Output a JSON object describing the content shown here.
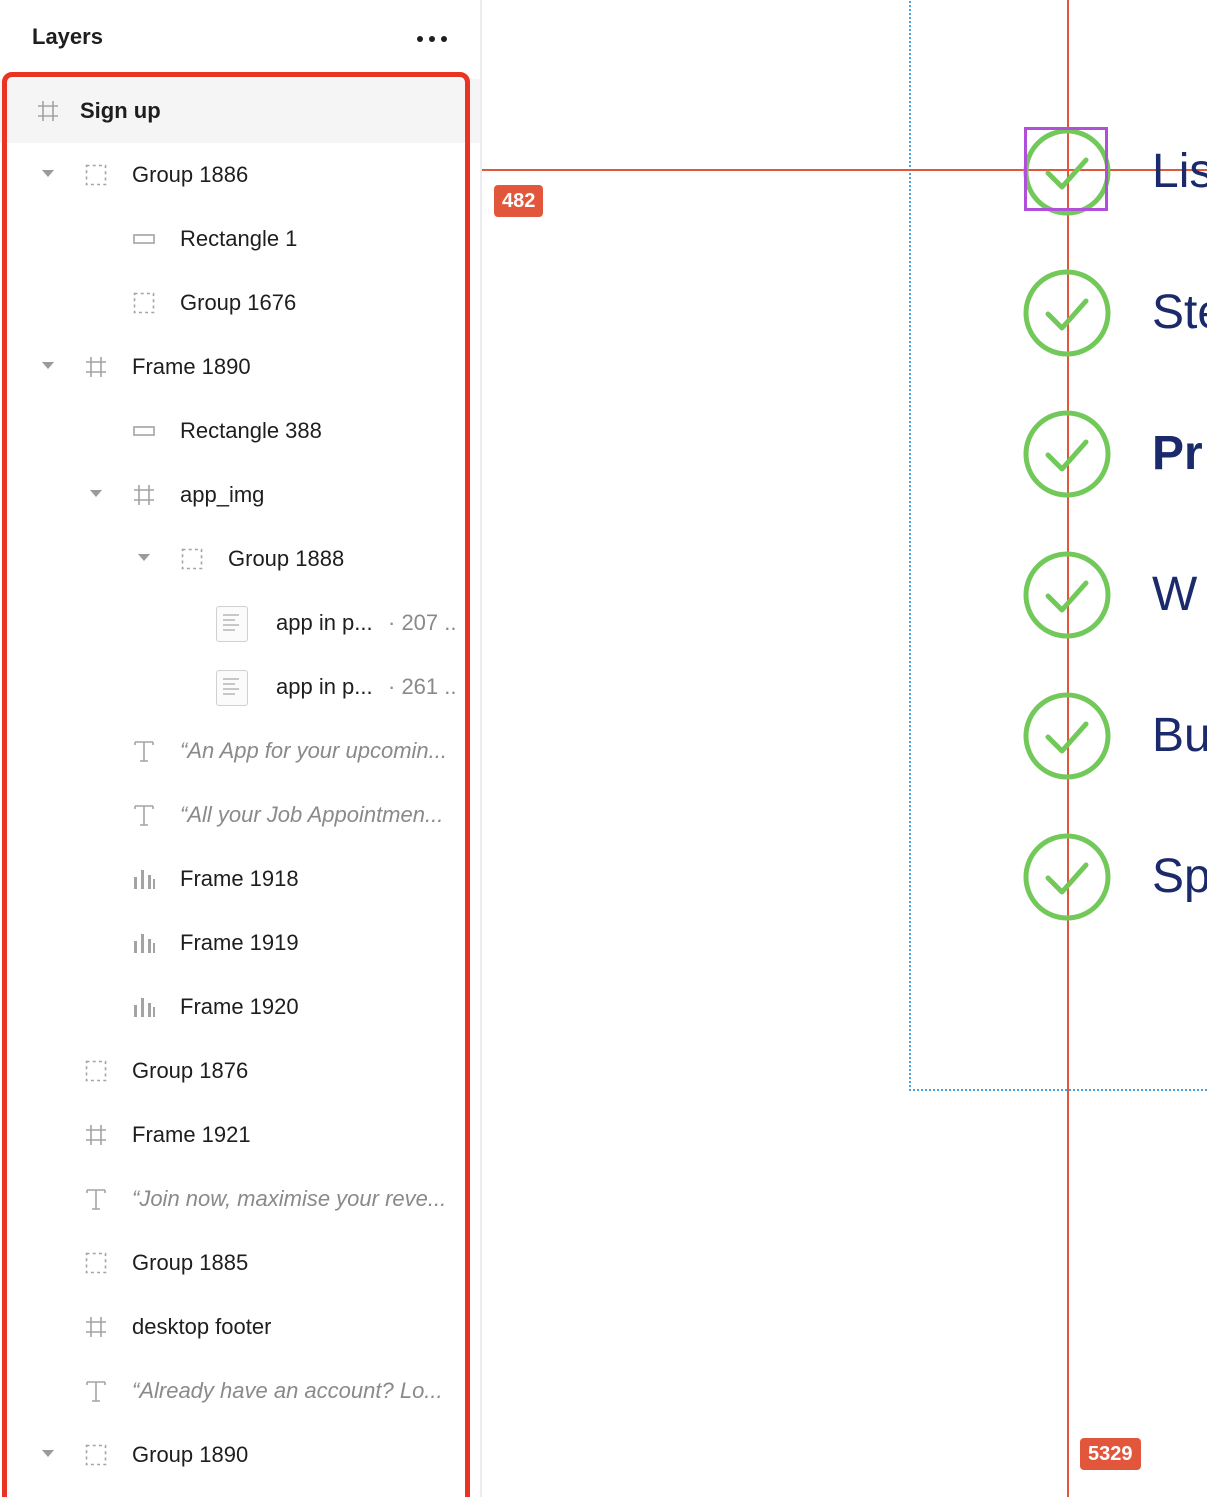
{
  "layers_panel": {
    "title": "Layers",
    "more_icon": "more-horizontal-icon",
    "layers": [
      {
        "id": "sign-up",
        "label": "Sign up",
        "icon": "frame",
        "level": 0,
        "expandable": false,
        "selected": true
      },
      {
        "id": "group-1886",
        "label": "Group 1886",
        "icon": "group",
        "level": 1,
        "expandable": true
      },
      {
        "id": "rectangle-1",
        "label": "Rectangle 1",
        "icon": "rectangle",
        "level": 2
      },
      {
        "id": "group-1676",
        "label": "Group 1676",
        "icon": "group",
        "level": 2
      },
      {
        "id": "frame-1890",
        "label": "Frame 1890",
        "icon": "frame",
        "level": 1,
        "expandable": true
      },
      {
        "id": "rectangle-388",
        "label": "Rectangle 388",
        "icon": "rectangle",
        "level": 2
      },
      {
        "id": "app-img",
        "label": "app_img",
        "icon": "frame",
        "level": 2,
        "expandable": true
      },
      {
        "id": "group-1888",
        "label": "Group 1888",
        "icon": "group",
        "level": 3,
        "expandable": true
      },
      {
        "id": "app-in-p-1",
        "label": "app in p...",
        "meta": "· 207 ...",
        "icon": "image",
        "level": 4
      },
      {
        "id": "app-in-p-2",
        "label": "app in p...",
        "meta": "· 261 ...",
        "icon": "image",
        "level": 4
      },
      {
        "id": "text-an-app",
        "label": "“An App for your upcomin...",
        "icon": "text",
        "level": 2
      },
      {
        "id": "text-all-your",
        "label": "“All your Job Appointmen...",
        "icon": "text",
        "level": 2
      },
      {
        "id": "frame-1918",
        "label": "Frame 1918",
        "icon": "bars",
        "level": 2
      },
      {
        "id": "frame-1919",
        "label": "Frame 1919",
        "icon": "bars",
        "level": 2
      },
      {
        "id": "frame-1920",
        "label": "Frame 1920",
        "icon": "bars",
        "level": 2
      },
      {
        "id": "group-1876",
        "label": "Group 1876",
        "icon": "group",
        "level": 1
      },
      {
        "id": "frame-1921",
        "label": "Frame 1921",
        "icon": "frame",
        "level": 1
      },
      {
        "id": "text-join-now",
        "label": "“Join now, maximise your reve...",
        "icon": "text",
        "level": 1
      },
      {
        "id": "group-1885",
        "label": "Group 1885",
        "icon": "group",
        "level": 1
      },
      {
        "id": "desktop-footer",
        "label": "desktop footer",
        "icon": "frame",
        "level": 1
      },
      {
        "id": "text-already",
        "label": "“Already have an account? Lo...",
        "icon": "text",
        "level": 1
      },
      {
        "id": "group-1890",
        "label": "Group 1890",
        "icon": "group",
        "level": 1,
        "expandable": true
      }
    ]
  },
  "canvas": {
    "measure_badges": {
      "horizontal": "482",
      "vertical": "5329"
    },
    "check_items": [
      {
        "text": "Lis",
        "bold": false
      },
      {
        "text": "Ste",
        "bold": false
      },
      {
        "text": "Pr",
        "bold": true
      },
      {
        "text": "W",
        "bold": false
      },
      {
        "text": "Bu",
        "bold": false
      },
      {
        "text": "Sp",
        "bold": false
      }
    ],
    "colors": {
      "guide_red": "#e2573c",
      "guide_blue": "#4a9fe0",
      "check_green": "#72c95a",
      "text_navy": "#1b2a6b",
      "selection_purple": "#b04fd8",
      "highlight_red": "#ea3323"
    }
  }
}
